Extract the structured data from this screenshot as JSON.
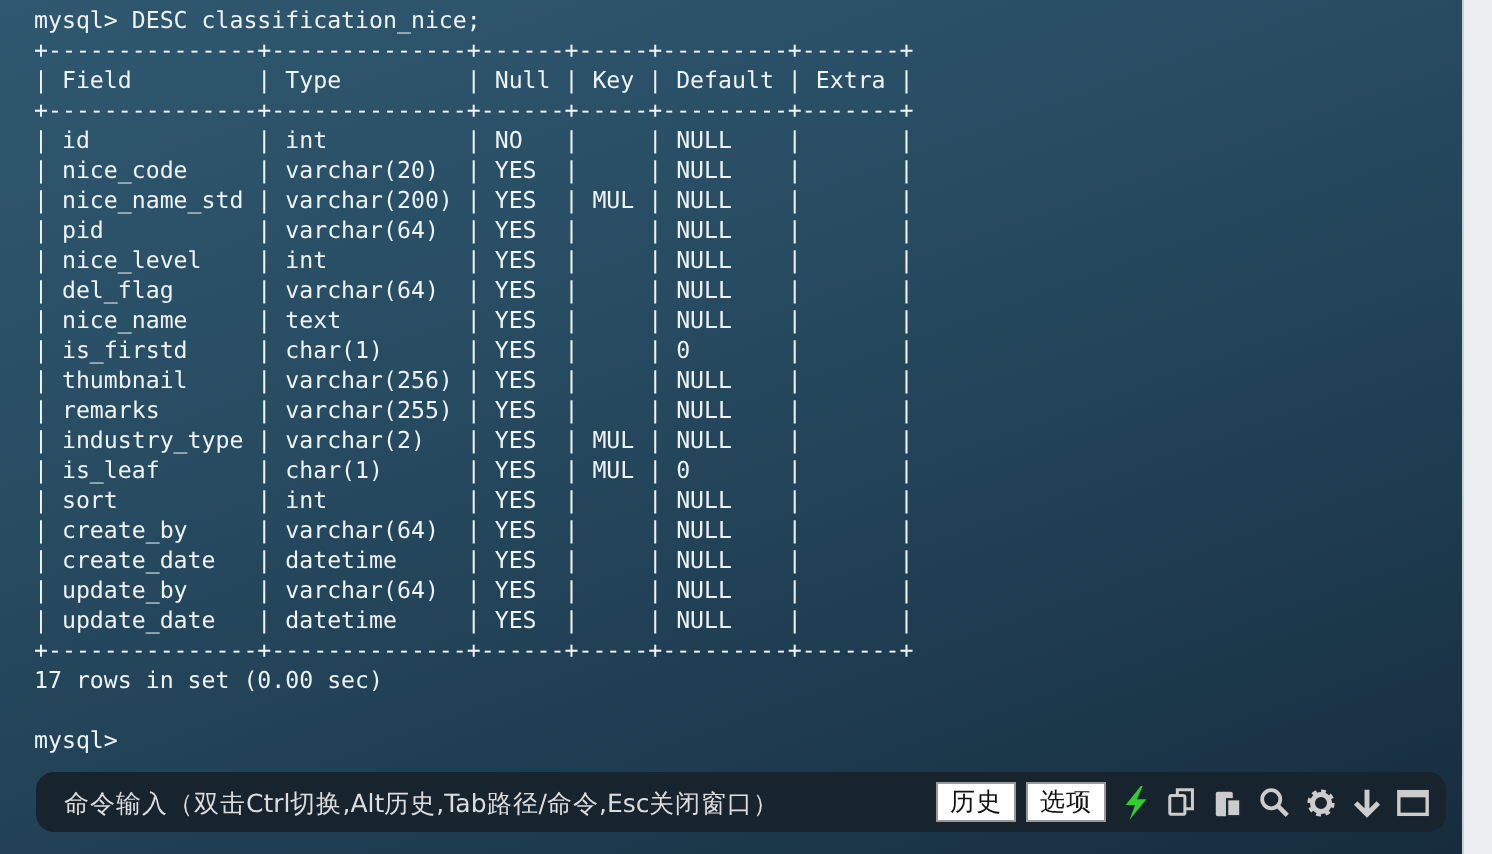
{
  "terminal": {
    "command": "mysql> DESC classification_nice;",
    "table": {
      "border": "+---------------+--------------+------+-----+---------+-------+",
      "separator": "|",
      "columns": [
        "Field",
        "Type",
        "Null",
        "Key",
        "Default",
        "Extra"
      ],
      "rows": [
        [
          "id",
          "int",
          "NO",
          "",
          "NULL",
          ""
        ],
        [
          "nice_code",
          "varchar(20)",
          "YES",
          "",
          "NULL",
          ""
        ],
        [
          "nice_name_std",
          "varchar(200)",
          "YES",
          "MUL",
          "NULL",
          ""
        ],
        [
          "pid",
          "varchar(64)",
          "YES",
          "",
          "NULL",
          ""
        ],
        [
          "nice_level",
          "int",
          "YES",
          "",
          "NULL",
          ""
        ],
        [
          "del_flag",
          "varchar(64)",
          "YES",
          "",
          "NULL",
          ""
        ],
        [
          "nice_name",
          "text",
          "YES",
          "",
          "NULL",
          ""
        ],
        [
          "is_firstd",
          "char(1)",
          "YES",
          "",
          "0",
          ""
        ],
        [
          "thumbnail",
          "varchar(256)",
          "YES",
          "",
          "NULL",
          ""
        ],
        [
          "remarks",
          "varchar(255)",
          "YES",
          "",
          "NULL",
          ""
        ],
        [
          "industry_type",
          "varchar(2)",
          "YES",
          "MUL",
          "NULL",
          ""
        ],
        [
          "is_leaf",
          "char(1)",
          "YES",
          "MUL",
          "0",
          ""
        ],
        [
          "sort",
          "int",
          "YES",
          "",
          "NULL",
          ""
        ],
        [
          "create_by",
          "varchar(64)",
          "YES",
          "",
          "NULL",
          ""
        ],
        [
          "create_date",
          "datetime",
          "YES",
          "",
          "NULL",
          ""
        ],
        [
          "update_by",
          "varchar(64)",
          "YES",
          "",
          "NULL",
          ""
        ],
        [
          "update_date",
          "datetime",
          "YES",
          "",
          "NULL",
          ""
        ]
      ]
    },
    "summary": "17 rows in set (0.00 sec)",
    "prompt": "mysql>"
  },
  "command_bar": {
    "placeholder": "命令输入（双击Ctrl切换,Alt历史,Tab路径/命令,Esc关闭窗口）",
    "buttons": [
      "历史",
      "选项"
    ]
  }
}
